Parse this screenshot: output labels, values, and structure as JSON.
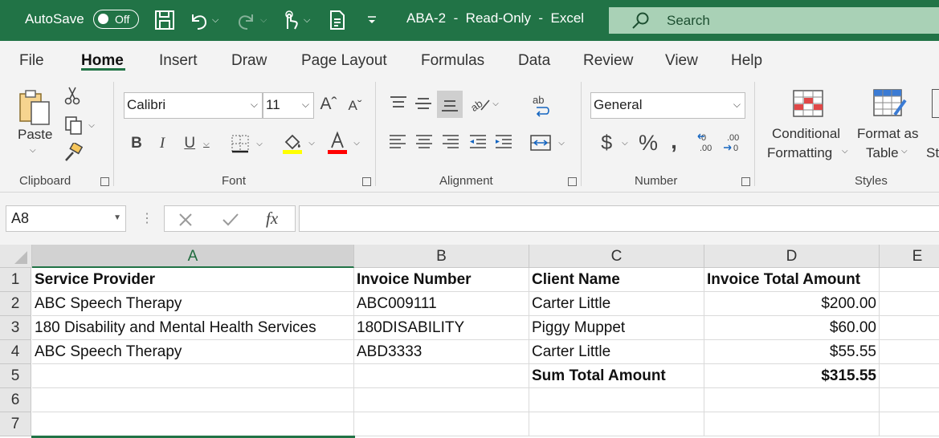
{
  "titlebar": {
    "autosave_label": "AutoSave",
    "autosave_state": "Off",
    "document_title": "ABA-2  -  Read-Only  -  Excel",
    "search_placeholder": "Search"
  },
  "tabs": [
    "File",
    "Home",
    "Insert",
    "Draw",
    "Page Layout",
    "Formulas",
    "Data",
    "Review",
    "View",
    "Help"
  ],
  "active_tab": "Home",
  "ribbon": {
    "clipboard": {
      "label": "Clipboard",
      "paste_label": "Paste"
    },
    "font": {
      "label": "Font",
      "font_name": "Calibri",
      "font_size": "11",
      "bold": "B",
      "italic": "I",
      "underline": "U"
    },
    "alignment": {
      "label": "Alignment"
    },
    "number": {
      "label": "Number",
      "format": "General",
      "currency": "$",
      "percent": "%",
      "comma": "9"
    },
    "styles": {
      "label": "Styles",
      "conditional_formatting_line1": "Conditional",
      "conditional_formatting_line2": "Formatting",
      "format_as_table_line1": "Format as",
      "format_as_table_line2": "Table",
      "cell_styles_partial": "St"
    },
    "colors": {
      "highlight": "#ffff00",
      "font_color": "#ff0000",
      "accent": "#217346"
    }
  },
  "formula_bar": {
    "name_box": "A8",
    "fx": "fx",
    "content": ""
  },
  "sheet": {
    "columns": [
      "A",
      "B",
      "C",
      "D",
      "E"
    ],
    "rows": [
      "1",
      "2",
      "3",
      "4",
      "5",
      "6",
      "7"
    ],
    "cells": {
      "A1": "Service Provider",
      "B1": "Invoice Number",
      "C1": "Client Name",
      "D1": "Invoice Total Amount",
      "A2": "ABC Speech Therapy",
      "B2": "ABC009111",
      "C2": "Carter Little",
      "D2": "$200.00",
      "A3": "180 Disability and Mental Health Services",
      "B3": "180DISABILITY",
      "C3": "Piggy Muppet",
      "D3": "$60.00",
      "A4": "ABC Speech Therapy",
      "B4": "ABD3333",
      "C4": "Carter Little",
      "D4": "$55.55",
      "C5": "Sum Total Amount",
      "D5": "$315.55"
    }
  }
}
